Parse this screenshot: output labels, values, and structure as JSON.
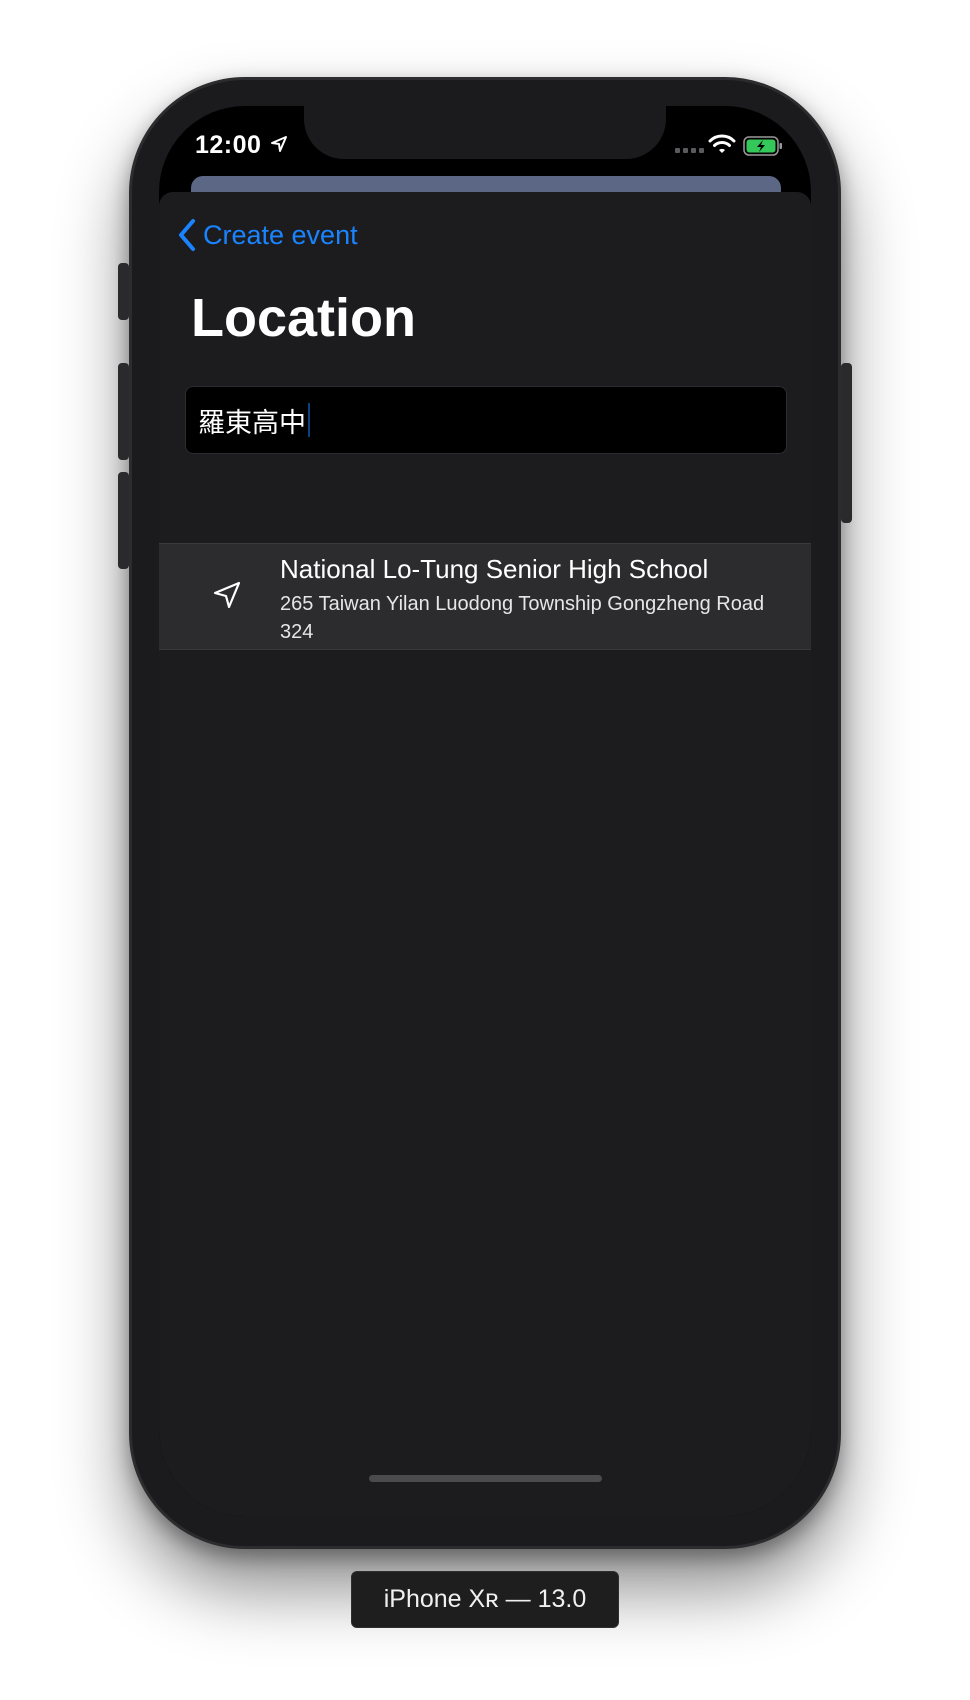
{
  "status_bar": {
    "time": "12:00",
    "location_icon": "location-arrow-icon",
    "signal_icon": "cellular-signal-icon",
    "wifi_icon": "wifi-icon",
    "battery_icon": "battery-charging-icon",
    "battery_color": "#34c759"
  },
  "nav": {
    "back_label": "Create event",
    "back_icon": "chevron-left-icon",
    "title": "Location"
  },
  "search": {
    "value": "羅東高中"
  },
  "results": [
    {
      "name": "National Lo-Tung Senior High School",
      "address": "265 Taiwan Yilan Luodong Township Gongzheng Road 324",
      "icon": "navigation-arrow-icon"
    }
  ],
  "device_label": "iPhone Xʀ — 13.0",
  "colors": {
    "accent": "#1a84ff",
    "sheet_background": "#1c1c1e",
    "row_background": "#2c2c2e",
    "peek_card": "#5c6785"
  }
}
